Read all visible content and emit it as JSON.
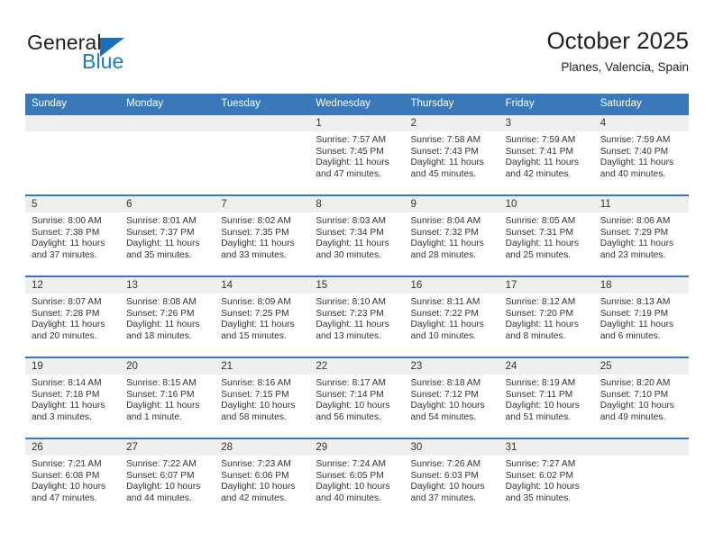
{
  "brand": {
    "name_part1": "General",
    "name_part2": "Blue",
    "triangle_color": "#1e6eb8",
    "blue_color": "#1e7ac0"
  },
  "header": {
    "title": "October 2025",
    "subtitle": "Planes, Valencia, Spain"
  },
  "theme": {
    "header_blue": "#3a78b9",
    "daynum_band": "#efefef",
    "text": "#333333"
  },
  "weekdays": [
    "Sunday",
    "Monday",
    "Tuesday",
    "Wednesday",
    "Thursday",
    "Friday",
    "Saturday"
  ],
  "weeks": [
    [
      {
        "day": "",
        "empty": true
      },
      {
        "day": "",
        "empty": true
      },
      {
        "day": "",
        "empty": true
      },
      {
        "day": "1",
        "sunrise": "Sunrise: 7:57 AM",
        "sunset": "Sunset: 7:45 PM",
        "daylight1": "Daylight: 11 hours",
        "daylight2": "and 47 minutes."
      },
      {
        "day": "2",
        "sunrise": "Sunrise: 7:58 AM",
        "sunset": "Sunset: 7:43 PM",
        "daylight1": "Daylight: 11 hours",
        "daylight2": "and 45 minutes."
      },
      {
        "day": "3",
        "sunrise": "Sunrise: 7:59 AM",
        "sunset": "Sunset: 7:41 PM",
        "daylight1": "Daylight: 11 hours",
        "daylight2": "and 42 minutes."
      },
      {
        "day": "4",
        "sunrise": "Sunrise: 7:59 AM",
        "sunset": "Sunset: 7:40 PM",
        "daylight1": "Daylight: 11 hours",
        "daylight2": "and 40 minutes."
      }
    ],
    [
      {
        "day": "5",
        "sunrise": "Sunrise: 8:00 AM",
        "sunset": "Sunset: 7:38 PM",
        "daylight1": "Daylight: 11 hours",
        "daylight2": "and 37 minutes."
      },
      {
        "day": "6",
        "sunrise": "Sunrise: 8:01 AM",
        "sunset": "Sunset: 7:37 PM",
        "daylight1": "Daylight: 11 hours",
        "daylight2": "and 35 minutes."
      },
      {
        "day": "7",
        "sunrise": "Sunrise: 8:02 AM",
        "sunset": "Sunset: 7:35 PM",
        "daylight1": "Daylight: 11 hours",
        "daylight2": "and 33 minutes."
      },
      {
        "day": "8",
        "sunrise": "Sunrise: 8:03 AM",
        "sunset": "Sunset: 7:34 PM",
        "daylight1": "Daylight: 11 hours",
        "daylight2": "and 30 minutes."
      },
      {
        "day": "9",
        "sunrise": "Sunrise: 8:04 AM",
        "sunset": "Sunset: 7:32 PM",
        "daylight1": "Daylight: 11 hours",
        "daylight2": "and 28 minutes."
      },
      {
        "day": "10",
        "sunrise": "Sunrise: 8:05 AM",
        "sunset": "Sunset: 7:31 PM",
        "daylight1": "Daylight: 11 hours",
        "daylight2": "and 25 minutes."
      },
      {
        "day": "11",
        "sunrise": "Sunrise: 8:06 AM",
        "sunset": "Sunset: 7:29 PM",
        "daylight1": "Daylight: 11 hours",
        "daylight2": "and 23 minutes."
      }
    ],
    [
      {
        "day": "12",
        "sunrise": "Sunrise: 8:07 AM",
        "sunset": "Sunset: 7:28 PM",
        "daylight1": "Daylight: 11 hours",
        "daylight2": "and 20 minutes."
      },
      {
        "day": "13",
        "sunrise": "Sunrise: 8:08 AM",
        "sunset": "Sunset: 7:26 PM",
        "daylight1": "Daylight: 11 hours",
        "daylight2": "and 18 minutes."
      },
      {
        "day": "14",
        "sunrise": "Sunrise: 8:09 AM",
        "sunset": "Sunset: 7:25 PM",
        "daylight1": "Daylight: 11 hours",
        "daylight2": "and 15 minutes."
      },
      {
        "day": "15",
        "sunrise": "Sunrise: 8:10 AM",
        "sunset": "Sunset: 7:23 PM",
        "daylight1": "Daylight: 11 hours",
        "daylight2": "and 13 minutes."
      },
      {
        "day": "16",
        "sunrise": "Sunrise: 8:11 AM",
        "sunset": "Sunset: 7:22 PM",
        "daylight1": "Daylight: 11 hours",
        "daylight2": "and 10 minutes."
      },
      {
        "day": "17",
        "sunrise": "Sunrise: 8:12 AM",
        "sunset": "Sunset: 7:20 PM",
        "daylight1": "Daylight: 11 hours",
        "daylight2": "and 8 minutes."
      },
      {
        "day": "18",
        "sunrise": "Sunrise: 8:13 AM",
        "sunset": "Sunset: 7:19 PM",
        "daylight1": "Daylight: 11 hours",
        "daylight2": "and 6 minutes."
      }
    ],
    [
      {
        "day": "19",
        "sunrise": "Sunrise: 8:14 AM",
        "sunset": "Sunset: 7:18 PM",
        "daylight1": "Daylight: 11 hours",
        "daylight2": "and 3 minutes."
      },
      {
        "day": "20",
        "sunrise": "Sunrise: 8:15 AM",
        "sunset": "Sunset: 7:16 PM",
        "daylight1": "Daylight: 11 hours",
        "daylight2": "and 1 minute."
      },
      {
        "day": "21",
        "sunrise": "Sunrise: 8:16 AM",
        "sunset": "Sunset: 7:15 PM",
        "daylight1": "Daylight: 10 hours",
        "daylight2": "and 58 minutes."
      },
      {
        "day": "22",
        "sunrise": "Sunrise: 8:17 AM",
        "sunset": "Sunset: 7:14 PM",
        "daylight1": "Daylight: 10 hours",
        "daylight2": "and 56 minutes."
      },
      {
        "day": "23",
        "sunrise": "Sunrise: 8:18 AM",
        "sunset": "Sunset: 7:12 PM",
        "daylight1": "Daylight: 10 hours",
        "daylight2": "and 54 minutes."
      },
      {
        "day": "24",
        "sunrise": "Sunrise: 8:19 AM",
        "sunset": "Sunset: 7:11 PM",
        "daylight1": "Daylight: 10 hours",
        "daylight2": "and 51 minutes."
      },
      {
        "day": "25",
        "sunrise": "Sunrise: 8:20 AM",
        "sunset": "Sunset: 7:10 PM",
        "daylight1": "Daylight: 10 hours",
        "daylight2": "and 49 minutes."
      }
    ],
    [
      {
        "day": "26",
        "sunrise": "Sunrise: 7:21 AM",
        "sunset": "Sunset: 6:08 PM",
        "daylight1": "Daylight: 10 hours",
        "daylight2": "and 47 minutes."
      },
      {
        "day": "27",
        "sunrise": "Sunrise: 7:22 AM",
        "sunset": "Sunset: 6:07 PM",
        "daylight1": "Daylight: 10 hours",
        "daylight2": "and 44 minutes."
      },
      {
        "day": "28",
        "sunrise": "Sunrise: 7:23 AM",
        "sunset": "Sunset: 6:06 PM",
        "daylight1": "Daylight: 10 hours",
        "daylight2": "and 42 minutes."
      },
      {
        "day": "29",
        "sunrise": "Sunrise: 7:24 AM",
        "sunset": "Sunset: 6:05 PM",
        "daylight1": "Daylight: 10 hours",
        "daylight2": "and 40 minutes."
      },
      {
        "day": "30",
        "sunrise": "Sunrise: 7:26 AM",
        "sunset": "Sunset: 6:03 PM",
        "daylight1": "Daylight: 10 hours",
        "daylight2": "and 37 minutes."
      },
      {
        "day": "31",
        "sunrise": "Sunrise: 7:27 AM",
        "sunset": "Sunset: 6:02 PM",
        "daylight1": "Daylight: 10 hours",
        "daylight2": "and 35 minutes."
      },
      {
        "day": "",
        "empty": true
      }
    ]
  ]
}
